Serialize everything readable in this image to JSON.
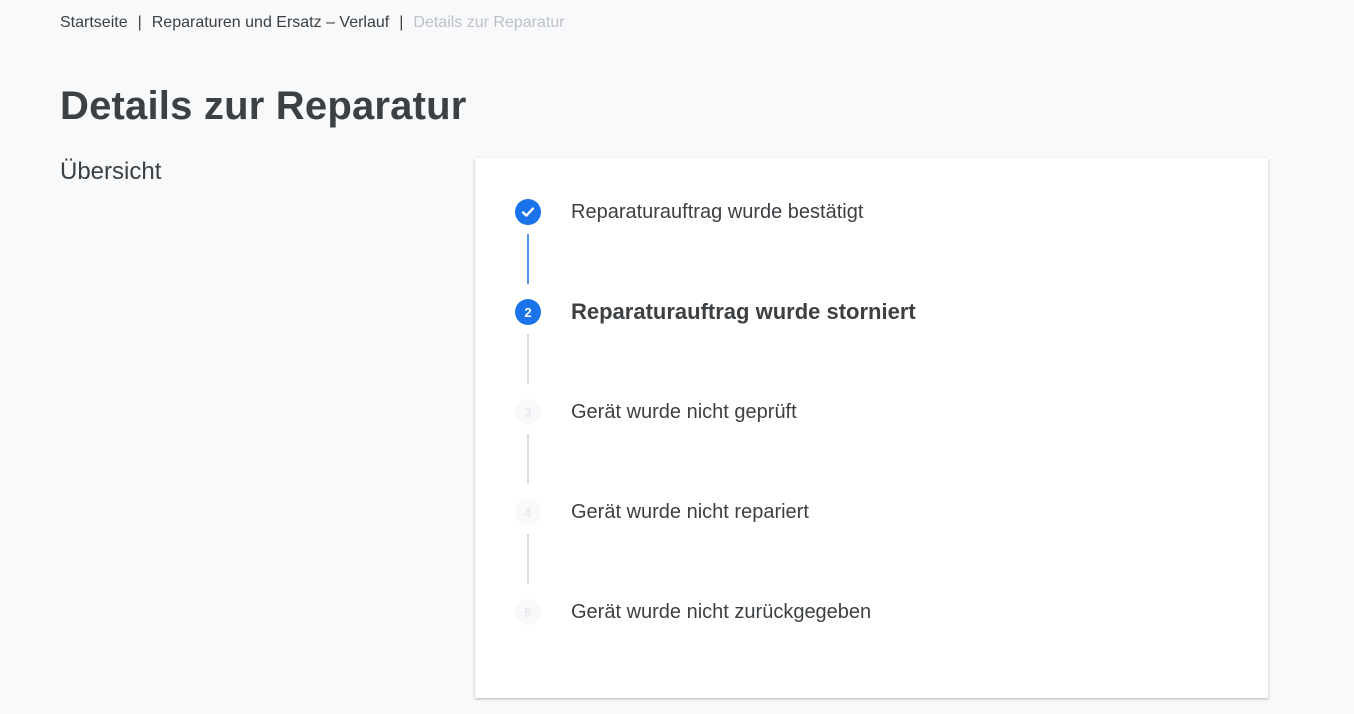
{
  "breadcrumb": {
    "items": [
      {
        "label": "Startseite"
      },
      {
        "label": "Reparaturen und Ersatz – Verlauf"
      },
      {
        "label": "Details zur Reparatur"
      }
    ],
    "separator": "|"
  },
  "page": {
    "title": "Details zur Reparatur",
    "section_label": "Übersicht"
  },
  "steps": [
    {
      "number": "1",
      "label": "Reparaturauftrag wurde bestätigt",
      "state": "done",
      "icon": "check-icon"
    },
    {
      "number": "2",
      "label": "Reparaturauftrag wurde storniert",
      "state": "active"
    },
    {
      "number": "3",
      "label": "Gerät wurde nicht geprüft",
      "state": "pending"
    },
    {
      "number": "4",
      "label": "Gerät wurde nicht repariert",
      "state": "pending"
    },
    {
      "number": "5",
      "label": "Gerät wurde nicht zurückgegeben",
      "state": "pending"
    }
  ],
  "colors": {
    "accent": "#1a73e8",
    "text": "#3c4043",
    "muted": "#bdc1c6",
    "background": "#f8f9fa"
  }
}
